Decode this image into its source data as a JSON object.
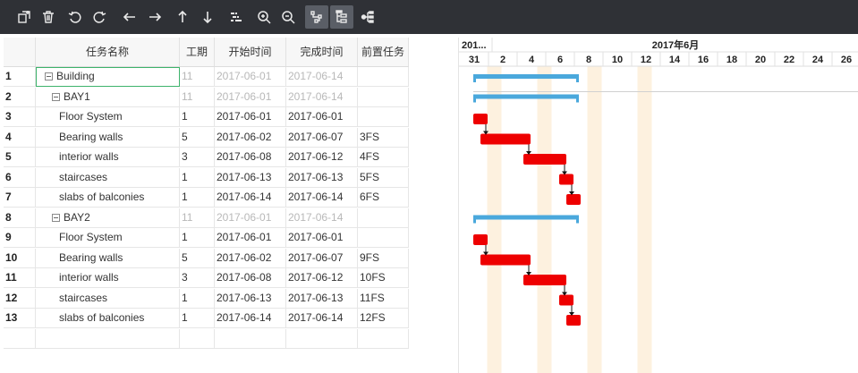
{
  "toolbar": {
    "buttons": [
      {
        "name": "add-task-icon",
        "active": false
      },
      {
        "name": "delete-icon",
        "active": false
      },
      {
        "name": "undo-icon",
        "active": false
      },
      {
        "name": "redo-icon",
        "active": false
      },
      {
        "name": "outdent-left-icon",
        "active": false
      },
      {
        "name": "indent-right-icon",
        "active": false
      },
      {
        "name": "move-up-icon",
        "active": false
      },
      {
        "name": "move-down-icon",
        "active": false
      },
      {
        "name": "link-tasks-icon",
        "active": false
      },
      {
        "name": "zoom-in-icon",
        "active": false
      },
      {
        "name": "zoom-out-icon",
        "active": false
      },
      {
        "name": "critical-path-icon",
        "active": true
      },
      {
        "name": "tree-view-icon",
        "active": true
      },
      {
        "name": "resource-view-icon",
        "active": false
      }
    ]
  },
  "grid": {
    "columns": [
      "",
      "任务名称",
      "工期",
      "开始时间",
      "完成时间",
      "前置任务"
    ],
    "rows": [
      {
        "id": "1",
        "name": "Building",
        "level": 0,
        "summary": true,
        "duration": "11",
        "start": "2017-06-01",
        "finish": "2017-06-14",
        "pred": ""
      },
      {
        "id": "2",
        "name": "BAY1",
        "level": 1,
        "summary": true,
        "duration": "11",
        "start": "2017-06-01",
        "finish": "2017-06-14",
        "pred": ""
      },
      {
        "id": "3",
        "name": "Floor System",
        "level": 2,
        "summary": false,
        "duration": "1",
        "start": "2017-06-01",
        "finish": "2017-06-01",
        "pred": ""
      },
      {
        "id": "4",
        "name": "Bearing walls",
        "level": 2,
        "summary": false,
        "duration": "5",
        "start": "2017-06-02",
        "finish": "2017-06-07",
        "pred": "3FS"
      },
      {
        "id": "5",
        "name": "interior walls",
        "level": 2,
        "summary": false,
        "duration": "3",
        "start": "2017-06-08",
        "finish": "2017-06-12",
        "pred": "4FS"
      },
      {
        "id": "6",
        "name": "staircases",
        "level": 2,
        "summary": false,
        "duration": "1",
        "start": "2017-06-13",
        "finish": "2017-06-13",
        "pred": "5FS"
      },
      {
        "id": "7",
        "name": "slabs of balconies",
        "level": 2,
        "summary": false,
        "duration": "1",
        "start": "2017-06-14",
        "finish": "2017-06-14",
        "pred": "6FS"
      },
      {
        "id": "8",
        "name": "BAY2",
        "level": 1,
        "summary": true,
        "duration": "11",
        "start": "2017-06-01",
        "finish": "2017-06-14",
        "pred": ""
      },
      {
        "id": "9",
        "name": "Floor System",
        "level": 2,
        "summary": false,
        "duration": "1",
        "start": "2017-06-01",
        "finish": "2017-06-01",
        "pred": ""
      },
      {
        "id": "10",
        "name": "Bearing walls",
        "level": 2,
        "summary": false,
        "duration": "5",
        "start": "2017-06-02",
        "finish": "2017-06-07",
        "pred": "9FS"
      },
      {
        "id": "11",
        "name": "interior walls",
        "level": 2,
        "summary": false,
        "duration": "3",
        "start": "2017-06-08",
        "finish": "2017-06-12",
        "pred": "10FS"
      },
      {
        "id": "12",
        "name": "staircases",
        "level": 2,
        "summary": false,
        "duration": "1",
        "start": "2017-06-13",
        "finish": "2017-06-13",
        "pred": "11FS"
      },
      {
        "id": "13",
        "name": "slabs of balconies",
        "level": 2,
        "summary": false,
        "duration": "1",
        "start": "2017-06-14",
        "finish": "2017-06-14",
        "pred": "12FS"
      }
    ]
  },
  "timeline": {
    "prev_label": "201...",
    "month_label": "2017年6月",
    "days": [
      "31",
      "2",
      "4",
      "6",
      "8",
      "10",
      "12",
      "14",
      "16",
      "18",
      "20",
      "22",
      "24",
      "26"
    ],
    "first_day": "2017-05-31",
    "weekend_bands": [
      "2017-06-03",
      "2017-06-10",
      "2017-06-17",
      "2017-06-24"
    ]
  },
  "colors": {
    "toolbar_bg": "#2f3136",
    "summary_bar": "#4aa8dc",
    "task_bar": "#ee0000",
    "weekend": "#fdf1df",
    "selection": "#3db36b"
  }
}
